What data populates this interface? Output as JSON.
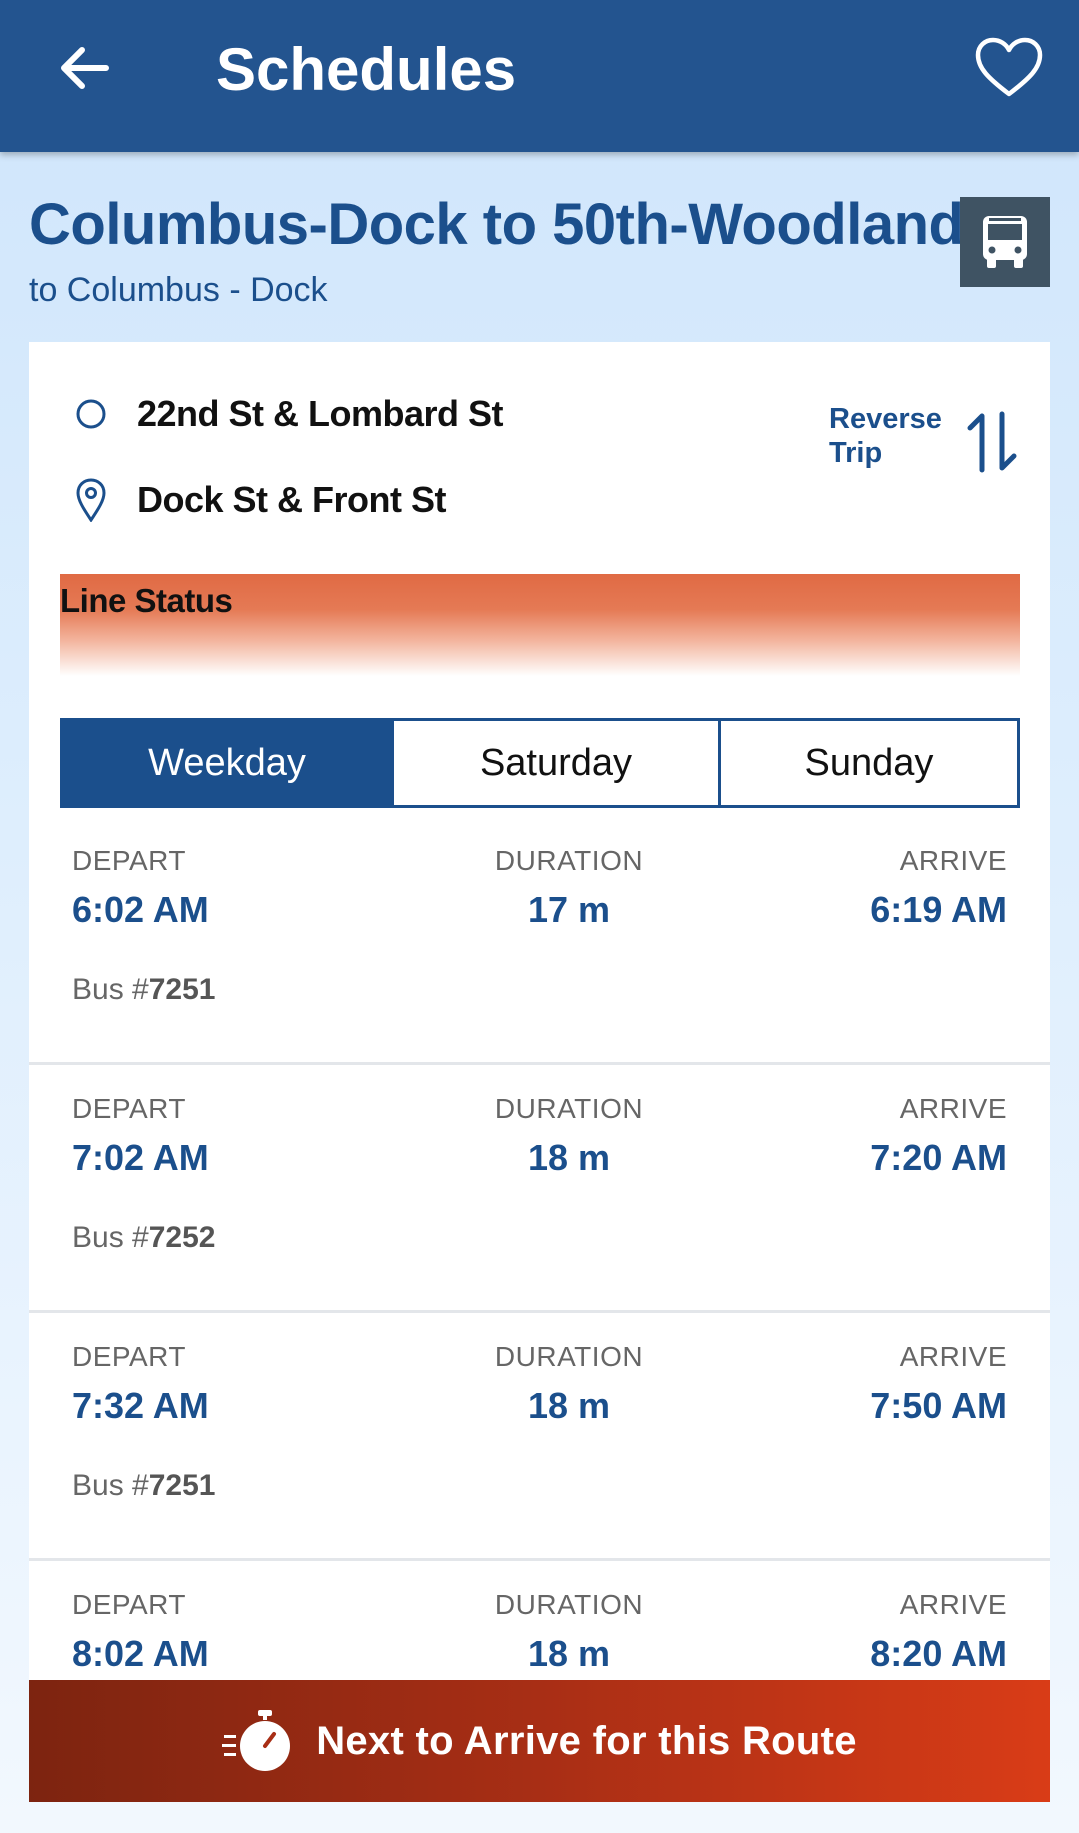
{
  "header": {
    "title": "Schedules",
    "back_icon": "arrow-left-icon",
    "favorite_icon": "heart-outline-icon"
  },
  "route": {
    "title": "Columbus-Dock to 50th-Woodland",
    "direction": "to Columbus - Dock",
    "mode_icon": "bus-icon"
  },
  "trip": {
    "origin": "22nd St & Lombard St",
    "destination": "Dock St & Front St",
    "reverse_label_line1": "Reverse",
    "reverse_label_line2": "Trip"
  },
  "line_status": {
    "label": "Line Status"
  },
  "tabs": [
    {
      "label": "Weekday",
      "active": true
    },
    {
      "label": "Saturday",
      "active": false
    },
    {
      "label": "Sunday",
      "active": false
    }
  ],
  "columns": {
    "depart": "DEPART",
    "duration": "DURATION",
    "arrive": "ARRIVE"
  },
  "trips": [
    {
      "depart": "6:02 AM",
      "duration": "17 m",
      "arrive": "6:19 AM",
      "bus_prefix": "Bus #",
      "bus_number": "7251"
    },
    {
      "depart": "7:02 AM",
      "duration": "18 m",
      "arrive": "7:20 AM",
      "bus_prefix": "Bus #",
      "bus_number": "7252"
    },
    {
      "depart": "7:32 AM",
      "duration": "18 m",
      "arrive": "7:50 AM",
      "bus_prefix": "Bus #",
      "bus_number": "7251"
    },
    {
      "depart": "8:02 AM",
      "duration": "18 m",
      "arrive": "8:20 AM",
      "bus_prefix": "",
      "bus_number": ""
    }
  ],
  "next_to_arrive": {
    "label": "Next to Arrive for this Route",
    "icon": "stopwatch-icon"
  },
  "colors": {
    "primary": "#23548f",
    "accent_text": "#1b4f8c",
    "cta_start": "#7d2410",
    "cta_end": "#d93c17"
  }
}
